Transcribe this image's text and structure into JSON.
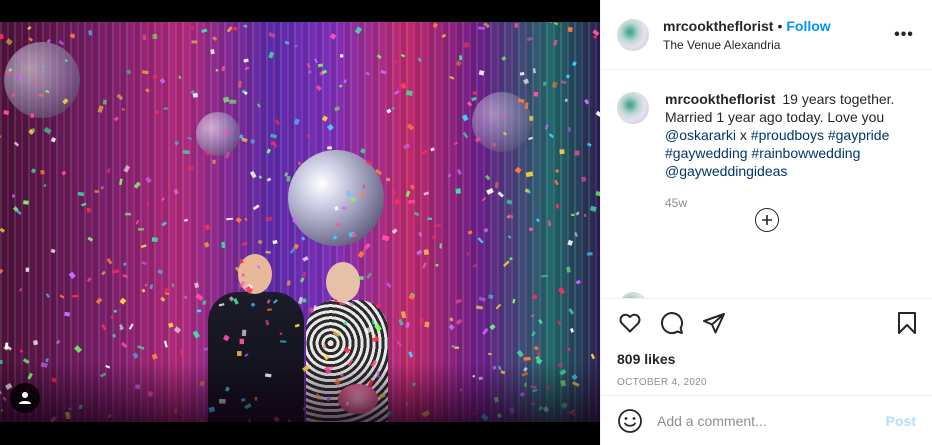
{
  "post": {
    "username": "mrcooktheflorist",
    "follow_label": "Follow",
    "separator": "•",
    "location": "The Venue Alexandria",
    "more_icon": "more-horizontal-icon",
    "more_glyph": "•••"
  },
  "caption": {
    "username": "mrcooktheflorist",
    "text": "19 years together. Married 1 year ago today. Love you",
    "mention": "@oskararki",
    "joiner": "x",
    "hashtags": [
      "#proudboys",
      "#gaypride",
      "#gaywedding",
      "#rainbowwedding"
    ],
    "mention2": "@gayweddingideas",
    "time": "45w"
  },
  "actions": {
    "icons": [
      "heart-icon",
      "comment-icon",
      "share-icon",
      "bookmark-icon"
    ],
    "likes": "809 likes",
    "date": "OCTOBER 4, 2020"
  },
  "add_comment": {
    "placeholder": "Add a comment...",
    "post_label": "Post",
    "emoji_icon": "emoji-icon"
  },
  "colors": {
    "accent": "#0095f6",
    "link": "#00376b",
    "muted": "#8e8e8e",
    "post_disabled": "#b2dffc"
  }
}
